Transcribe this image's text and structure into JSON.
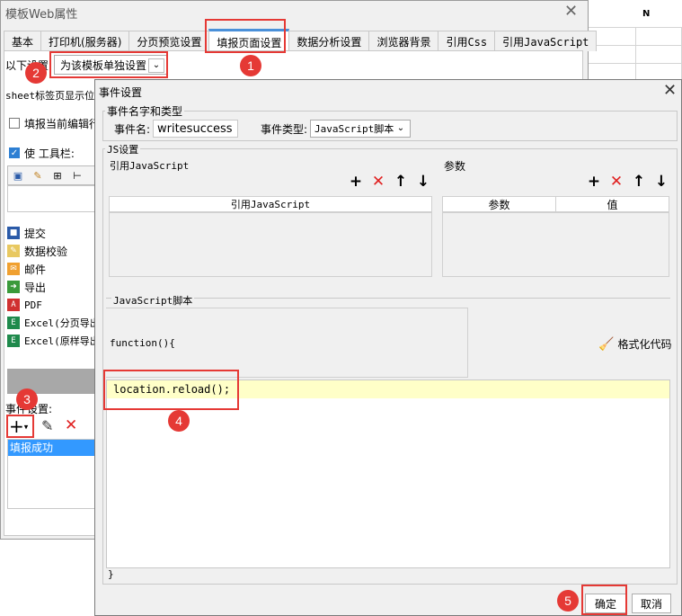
{
  "sheet": {
    "column_header": "N"
  },
  "back_dialog": {
    "title": "模板Web属性",
    "tabs": [
      "基本",
      "打印机(服务器)",
      "分页预览设置",
      "填报页面设置",
      "数据分析设置",
      "浏览器背景",
      "引用Css",
      "引用JavaScript"
    ],
    "active_tab": "填报页面设置",
    "settings_label": "以下设置",
    "settings_select_value": "为该模板单独设置",
    "sheet_label_text": "sheet标签页显示位",
    "current_edit_row_label": "填报当前编辑行",
    "use_toolbar_label": "使 工具栏:",
    "button_list": [
      "提交",
      "数据校验",
      "邮件",
      "导出",
      "PDF",
      "Excel(分页导出",
      "Excel(原样导出"
    ],
    "event_settings_label": "事件设置:",
    "event_list_selected": "填报成功"
  },
  "front_dialog": {
    "title": "事件设置",
    "name_type_legend": "事件名字和类型",
    "event_name_label": "事件名:",
    "event_name_value": "writesuccess",
    "event_type_label": "事件类型:",
    "event_type_value": "JavaScript脚本",
    "js_legend": "JS设置",
    "ref_js_label": "引用JavaScript",
    "params_label": "参数",
    "ref_js_column": "引用JavaScript",
    "param_columns": [
      "参数",
      "值"
    ],
    "script_label": "JavaScript脚本",
    "function_open": "function(){",
    "format_code_label": "格式化代码",
    "code_line": "location.reload();",
    "closing_brace": "}",
    "ok_label": "确定",
    "cancel_label": "取消"
  },
  "annotations": [
    "1",
    "2",
    "3",
    "4",
    "5"
  ],
  "colors": {
    "annotation_red": "#e53935",
    "selection_blue": "#3399ff",
    "highlight_yellow": "#ffffc8"
  }
}
